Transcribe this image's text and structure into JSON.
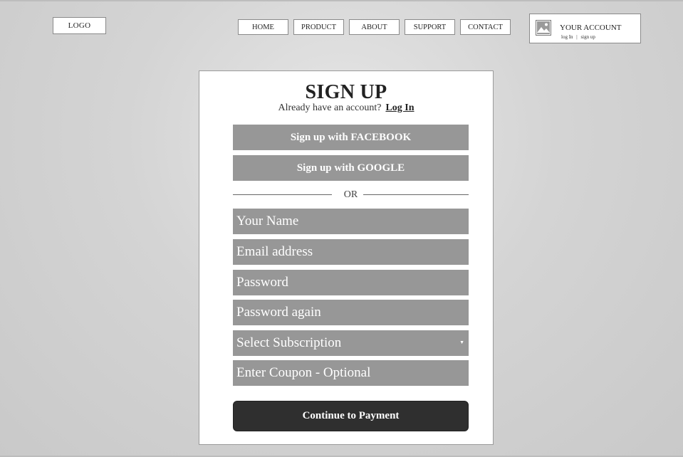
{
  "header": {
    "logo": "LOGO",
    "nav": [
      {
        "label": "HOME",
        "name": "nav-home"
      },
      {
        "label": "PRODUCT",
        "name": "nav-product"
      },
      {
        "label": "ABOUT",
        "name": "nav-about"
      },
      {
        "label": "SUPPORT",
        "name": "nav-support"
      },
      {
        "label": "CONTACT",
        "name": "nav-contact"
      }
    ],
    "account": {
      "title": "YOUR ACCOUNT",
      "login": "log In",
      "separator": "|",
      "signup": "sign up",
      "icon": "image-placeholder-icon"
    }
  },
  "form": {
    "title": "SIGN UP",
    "subtitle": "Already have an account?",
    "login_link": "Log In",
    "facebook": "Sign up with FACEBOOK",
    "google": "Sign up with GOOGLE",
    "or": "OR",
    "fields": {
      "name": "Your Name",
      "email": "Email address",
      "password": "Password",
      "password_again": "Password again",
      "subscription": "Select  Subscription",
      "coupon": "Enter Coupon - Optional"
    },
    "continue": "Continue to Payment"
  },
  "colors": {
    "field_bg": "#979797",
    "button_dark": "#2f2f2f"
  }
}
